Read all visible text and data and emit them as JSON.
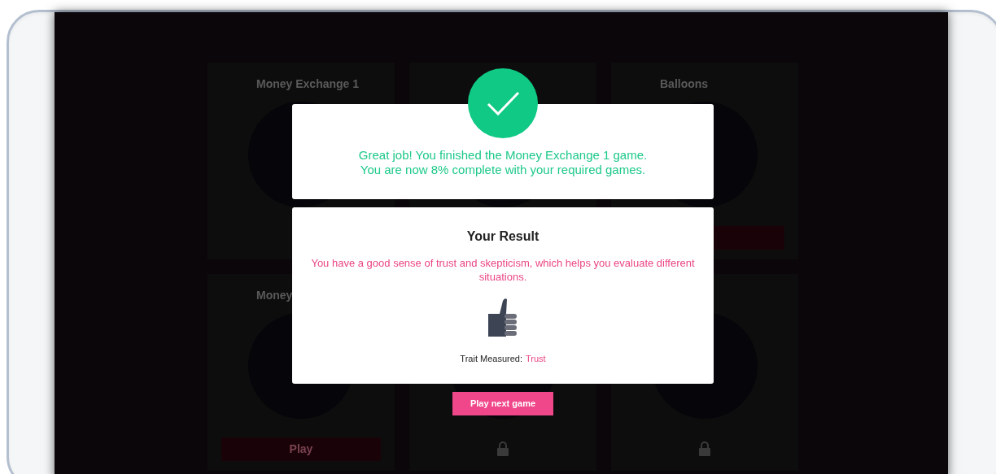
{
  "background_cards": [
    {
      "title": "Money Exchange 1",
      "action": {
        "kind": "none"
      }
    },
    {
      "action": {
        "kind": "none"
      }
    },
    {
      "title": "Balloons",
      "action": {
        "kind": "button"
      }
    },
    {
      "title": "Money",
      "action": {
        "kind": "play",
        "label": "Play"
      }
    },
    {
      "action": {
        "kind": "locked"
      }
    },
    {
      "action": {
        "kind": "locked"
      }
    }
  ],
  "success_panel": {
    "message_lines": [
      "Great job! You finished the Money Exchange 1 game.",
      "You are now 8% complete with your required games."
    ]
  },
  "result_panel": {
    "title": "Your Result",
    "description": "You have a good sense of trust and skepticism, which helps you evaluate different situations.",
    "trait_label": "Trait Measured:",
    "trait_value": "Trust"
  },
  "next_button": {
    "label": "Play next game"
  }
}
